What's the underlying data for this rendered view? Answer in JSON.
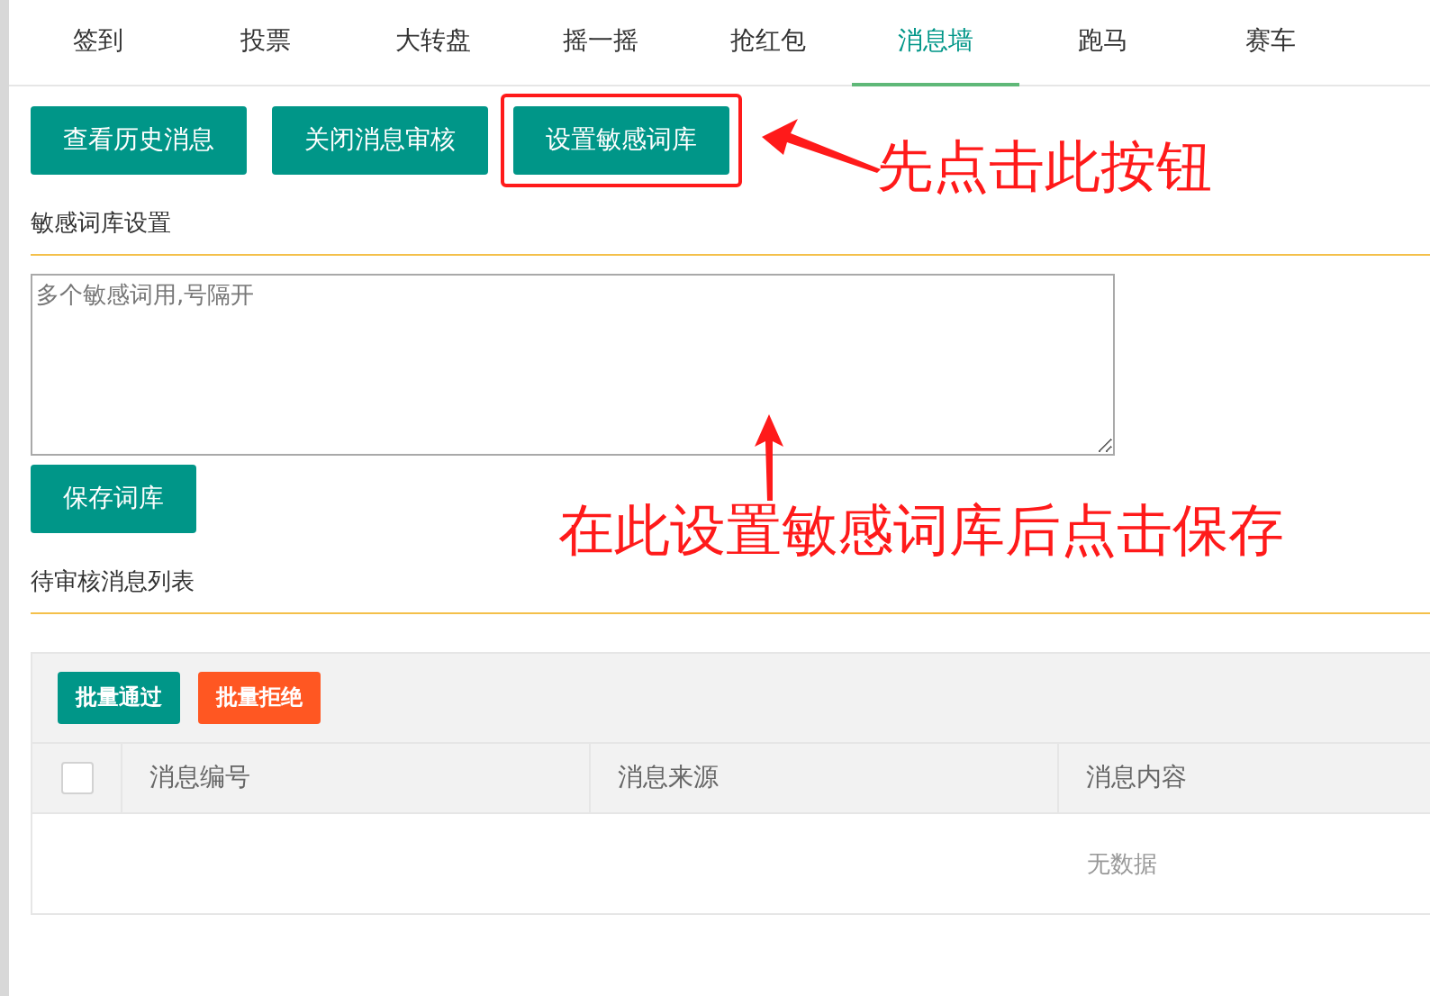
{
  "tabs": [
    {
      "label": "签到",
      "selected": false
    },
    {
      "label": "投票",
      "selected": false
    },
    {
      "label": "大转盘",
      "selected": false
    },
    {
      "label": "摇一摇",
      "selected": false
    },
    {
      "label": "抢红包",
      "selected": false
    },
    {
      "label": "消息墙",
      "selected": true
    },
    {
      "label": "跑马",
      "selected": false
    },
    {
      "label": "赛车",
      "selected": false
    }
  ],
  "actions": [
    {
      "label": "查看历史消息",
      "highlighted": false
    },
    {
      "label": "关闭消息审核",
      "highlighted": false
    },
    {
      "label": "设置敏感词库",
      "highlighted": true
    }
  ],
  "word_library": {
    "title": "敏感词库设置",
    "placeholder": "多个敏感词用,号隔开",
    "save_button": "保存词库"
  },
  "pending": {
    "title": "待审核消息列表",
    "batch_buttons": [
      {
        "label": "批量通过",
        "kind": "approve"
      },
      {
        "label": "批量拒绝",
        "kind": "reject"
      }
    ],
    "select_all": {
      "checked": false
    },
    "columns": [
      "消息编号",
      "消息来源",
      "消息内容"
    ],
    "empty_text": "无数据"
  },
  "annotations": [
    {
      "text": "先点击此按钮"
    },
    {
      "text": "在此设置敏感词库后点击保存"
    }
  ]
}
